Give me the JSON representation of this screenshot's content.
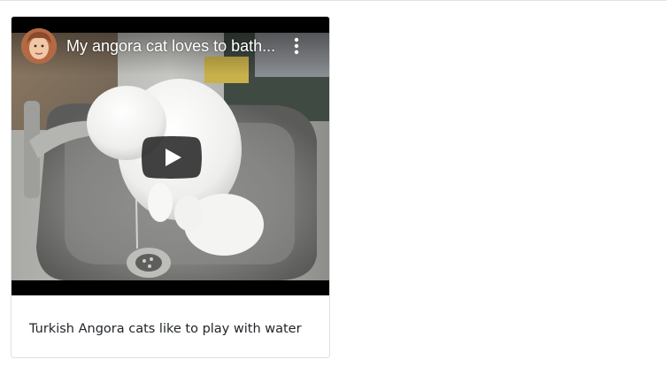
{
  "video": {
    "title": "My angora cat loves to bath...",
    "channel_avatar": "channel-avatar",
    "more_icon": "more-vert-icon",
    "play_icon": "play-icon"
  },
  "card": {
    "text": "Turkish Angora cats like to play with water"
  },
  "colors": {
    "card_border": "#dfe1e4",
    "text": "#212529",
    "play_button_bg": "#212121"
  }
}
